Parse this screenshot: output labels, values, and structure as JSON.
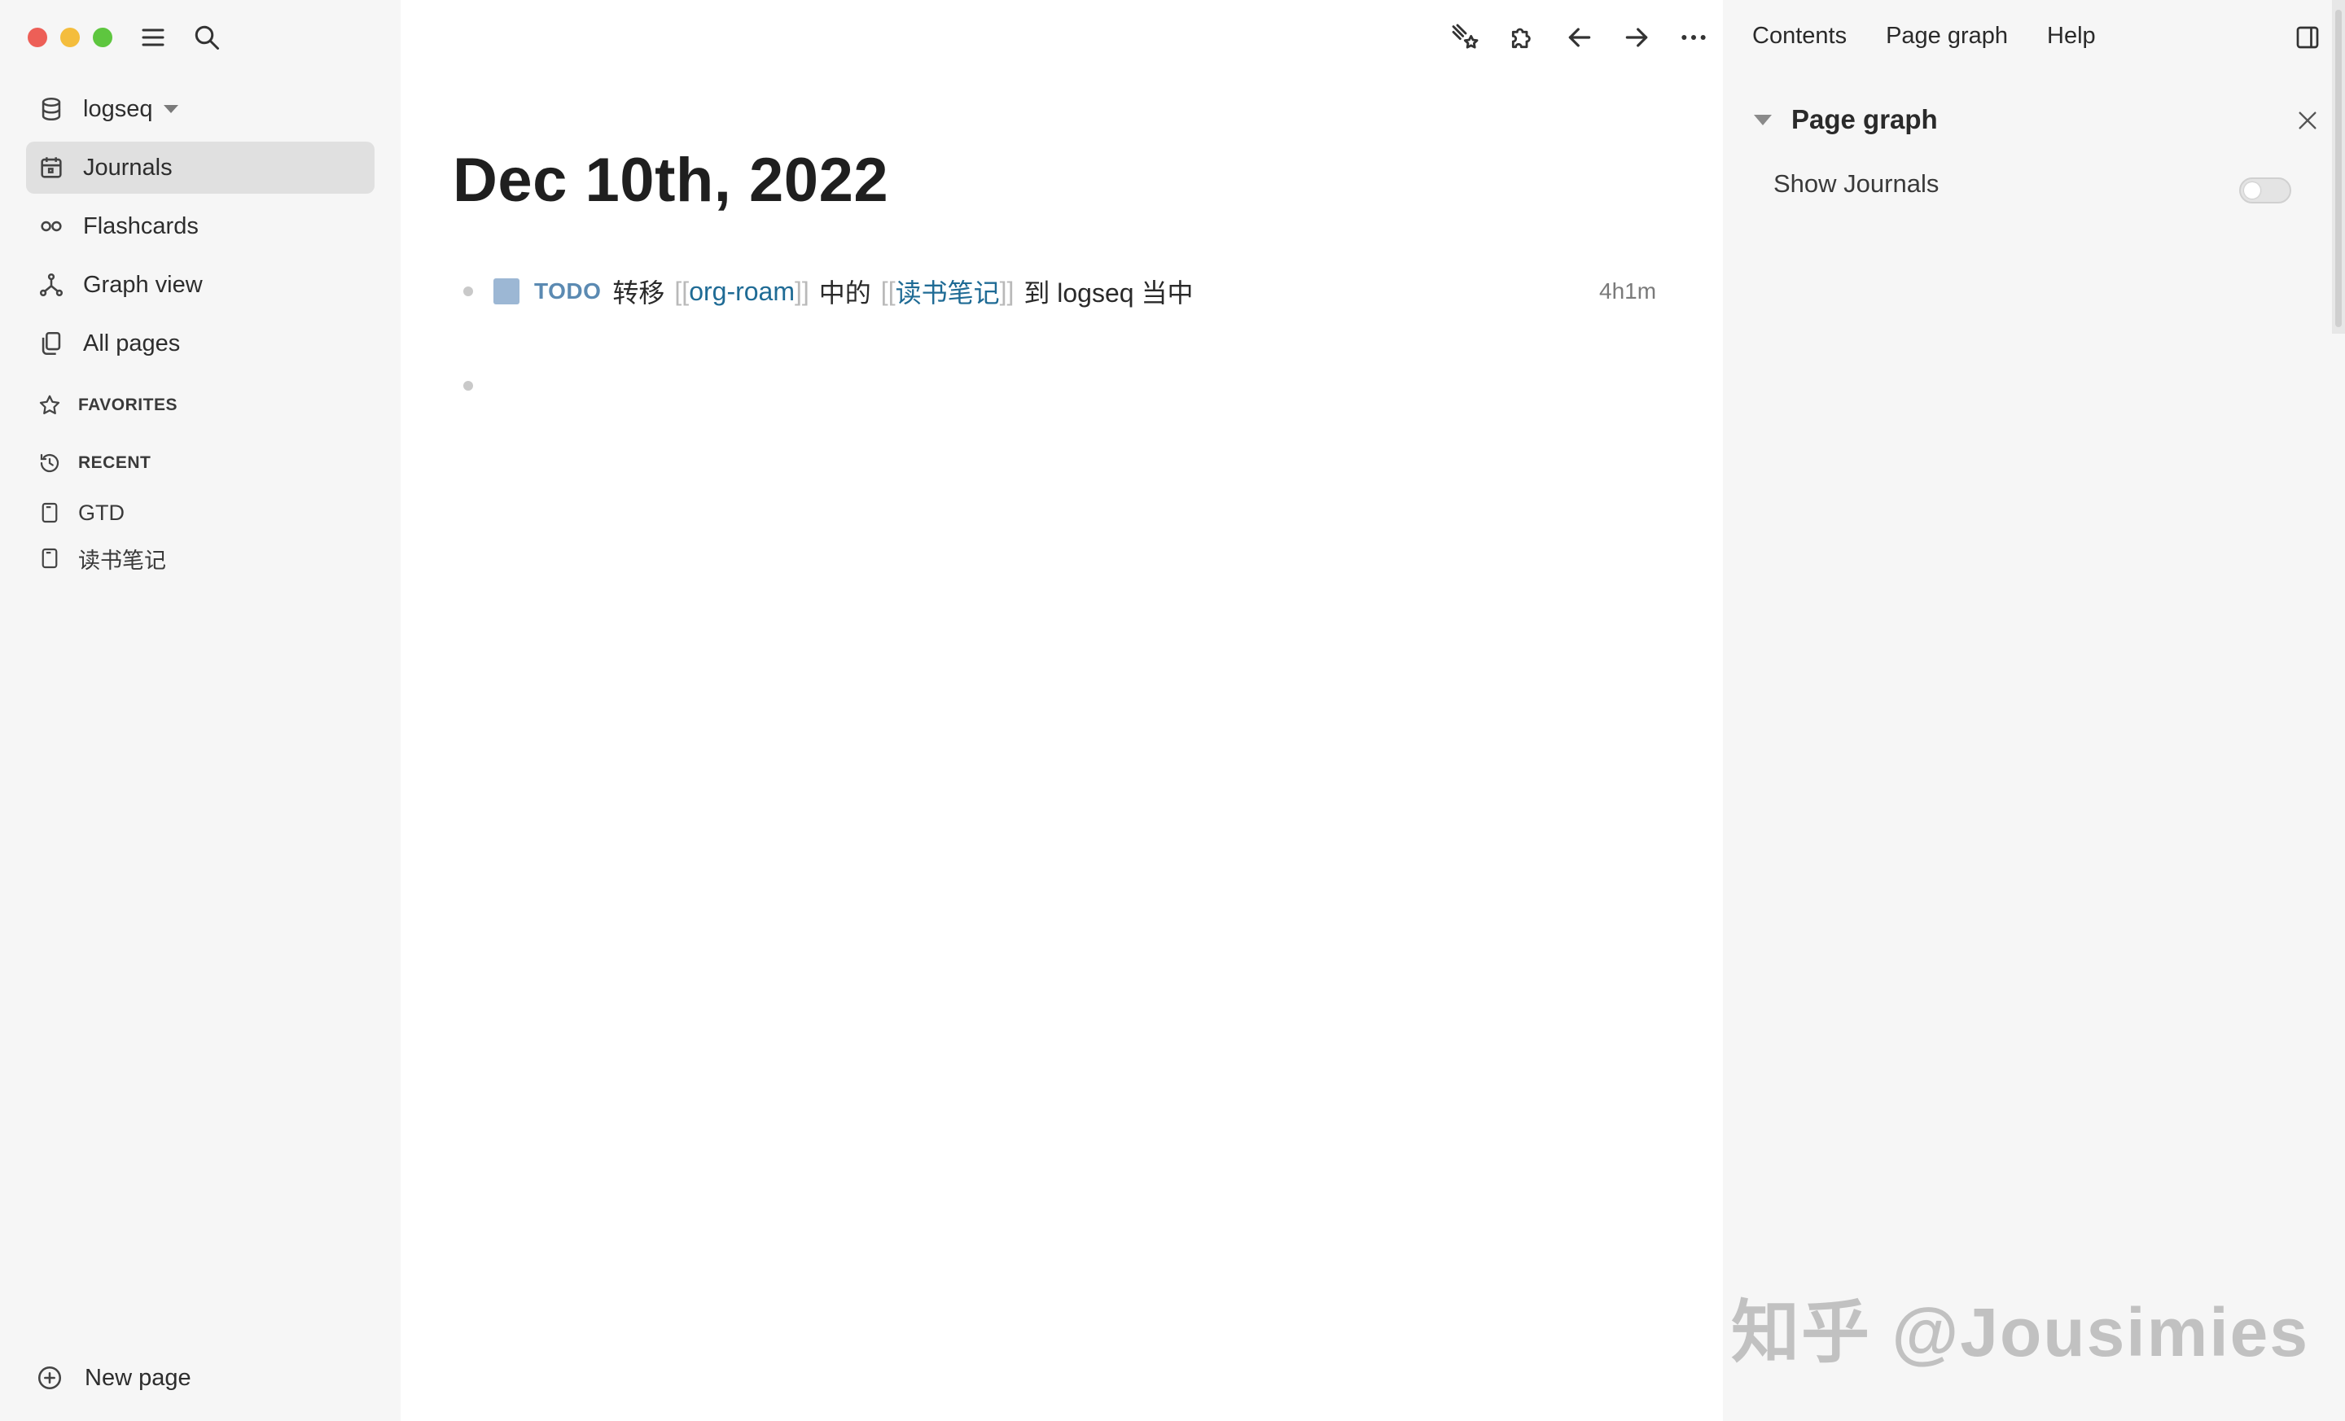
{
  "sidebar": {
    "graph_name": "logseq",
    "nav": [
      {
        "label": "Journals",
        "icon": "calendar-icon",
        "active": true
      },
      {
        "label": "Flashcards",
        "icon": "infinity-icon"
      },
      {
        "label": "Graph view",
        "icon": "graph-icon"
      },
      {
        "label": "All pages",
        "icon": "pages-icon"
      }
    ],
    "favorites_label": "FAVORITES",
    "recent_label": "RECENT",
    "recent": [
      {
        "label": "GTD"
      },
      {
        "label": "读书笔记"
      }
    ],
    "new_page_label": "New page"
  },
  "main": {
    "title": "Dec 10th, 2022",
    "block": {
      "marker": "TODO",
      "text_1": "转移",
      "ref_1": "org-roam",
      "text_2": "中的",
      "ref_2": "读书笔记",
      "text_3": "到 logseq 当中",
      "open_bracket": "[[",
      "close_bracket": "]]",
      "timer": "4h1m"
    }
  },
  "right_sidebar": {
    "tabs": [
      "Contents",
      "Page graph",
      "Help"
    ],
    "panel_title": "Page graph",
    "show_journals_label": "Show Journals",
    "show_journals_on": false
  },
  "watermark": "知乎 @Jousimies",
  "colors": {
    "todo": "#5b8ab2",
    "page_ref": "#1f6b95",
    "checkbox": "#9cb7d4",
    "sidebar_bg": "#f6f6f6"
  }
}
